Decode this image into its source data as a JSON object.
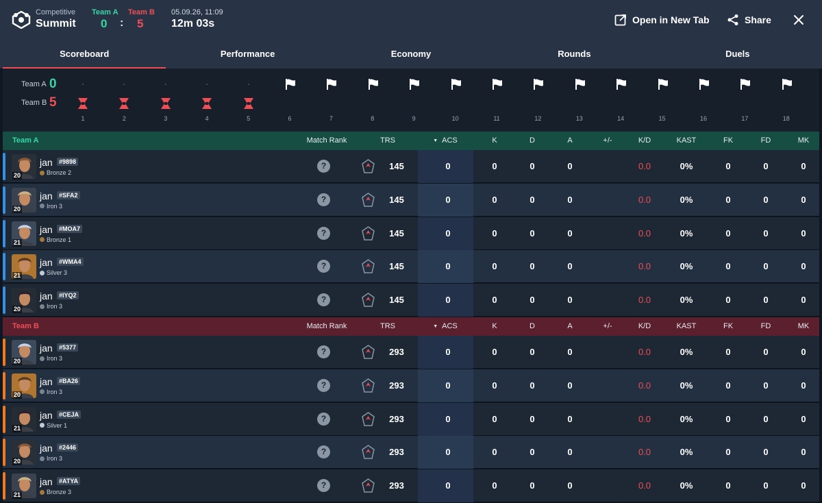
{
  "header": {
    "mode": "Competitive",
    "map": "Summit",
    "team_a_label": "Team A",
    "team_b_label": "Team B",
    "score_a": "0",
    "score_separator": ":",
    "score_b": "5",
    "date": "05.09.26, 11:09",
    "duration": "12m 03s",
    "open_new_tab": "Open in New Tab",
    "share": "Share"
  },
  "tabs": [
    "Scoreboard",
    "Performance",
    "Economy",
    "Rounds",
    "Duels"
  ],
  "active_tab": "Scoreboard",
  "timeline": {
    "team_a_label": "Team A",
    "team_a_score": "0",
    "team_b_label": "Team B",
    "team_b_score": "5",
    "rounds": [
      "1",
      "2",
      "3",
      "4",
      "5",
      "6",
      "7",
      "8",
      "9",
      "10",
      "11",
      "12",
      "13",
      "14",
      "15",
      "16",
      "17",
      "18"
    ],
    "team_b_won": [
      1,
      2,
      3,
      4,
      5
    ],
    "future_rounds": [
      6,
      7,
      8,
      9,
      10,
      11,
      12,
      13,
      14,
      15,
      16,
      17,
      18
    ]
  },
  "colors": {
    "team_a": "#38d6a4",
    "team_b": "#ef4e55",
    "team_a_header": "#174e43",
    "team_b_header": "#5b1f2d",
    "team_a_bar": "#3b8fe0",
    "team_b_bar": "#f07a24",
    "tab_underline": "#ef4e55"
  },
  "columns": {
    "match_rank": "Match Rank",
    "trs": "TRS",
    "acs": "ACS",
    "k": "K",
    "d": "D",
    "a": "A",
    "plus_minus": "+/-",
    "kd": "K/D",
    "kast": "KAST",
    "fk": "FK",
    "fd": "FD",
    "mk": "MK"
  },
  "teams": [
    {
      "name": "Team A",
      "players": [
        {
          "name": "jan",
          "tag": "#9898",
          "rank": "Bronze 2",
          "level": "20",
          "match_rank": "?",
          "trs": "145",
          "acs": "0",
          "k": "0",
          "d": "0",
          "a": "0",
          "plus_minus": "",
          "kd": "0.0",
          "kast": "0%",
          "fk": "0",
          "fd": "0",
          "mk": "0"
        },
        {
          "name": "jan",
          "tag": "#SFA2",
          "rank": "Iron 3",
          "level": "20",
          "match_rank": "?",
          "trs": "145",
          "acs": "0",
          "k": "0",
          "d": "0",
          "a": "0",
          "plus_minus": "",
          "kd": "0.0",
          "kast": "0%",
          "fk": "0",
          "fd": "0",
          "mk": "0"
        },
        {
          "name": "jan",
          "tag": "#MOA7",
          "rank": "Bronze 1",
          "level": "21",
          "match_rank": "?",
          "trs": "145",
          "acs": "0",
          "k": "0",
          "d": "0",
          "a": "0",
          "plus_minus": "",
          "kd": "0.0",
          "kast": "0%",
          "fk": "0",
          "fd": "0",
          "mk": "0"
        },
        {
          "name": "jan",
          "tag": "#WMA4",
          "rank": "Silver 3",
          "level": "21",
          "match_rank": "?",
          "trs": "145",
          "acs": "0",
          "k": "0",
          "d": "0",
          "a": "0",
          "plus_minus": "",
          "kd": "0.0",
          "kast": "0%",
          "fk": "0",
          "fd": "0",
          "mk": "0"
        },
        {
          "name": "jan",
          "tag": "#IYQ2",
          "rank": "Iron 3",
          "level": "20",
          "match_rank": "?",
          "trs": "145",
          "acs": "0",
          "k": "0",
          "d": "0",
          "a": "0",
          "plus_minus": "",
          "kd": "0.0",
          "kast": "0%",
          "fk": "0",
          "fd": "0",
          "mk": "0"
        }
      ]
    },
    {
      "name": "Team B",
      "players": [
        {
          "name": "jan",
          "tag": "#5377",
          "rank": "Iron 3",
          "level": "20",
          "match_rank": "?",
          "trs": "293",
          "acs": "0",
          "k": "0",
          "d": "0",
          "a": "0",
          "plus_minus": "",
          "kd": "0.0",
          "kast": "0%",
          "fk": "0",
          "fd": "0",
          "mk": "0"
        },
        {
          "name": "jan",
          "tag": "#BA26",
          "rank": "Iron 3",
          "level": "20",
          "match_rank": "?",
          "trs": "293",
          "acs": "0",
          "k": "0",
          "d": "0",
          "a": "0",
          "plus_minus": "",
          "kd": "0.0",
          "kast": "0%",
          "fk": "0",
          "fd": "0",
          "mk": "0"
        },
        {
          "name": "jan",
          "tag": "#CEJA",
          "rank": "Silver 1",
          "level": "21",
          "match_rank": "?",
          "trs": "293",
          "acs": "0",
          "k": "0",
          "d": "0",
          "a": "0",
          "plus_minus": "",
          "kd": "0.0",
          "kast": "0%",
          "fk": "0",
          "fd": "0",
          "mk": "0"
        },
        {
          "name": "jan",
          "tag": "#2446",
          "rank": "Iron 3",
          "level": "20",
          "match_rank": "?",
          "trs": "293",
          "acs": "0",
          "k": "0",
          "d": "0",
          "a": "0",
          "plus_minus": "",
          "kd": "0.0",
          "kast": "0%",
          "fk": "0",
          "fd": "0",
          "mk": "0"
        },
        {
          "name": "jan",
          "tag": "#ATYA",
          "rank": "Bronze 3",
          "level": "21",
          "match_rank": "?",
          "trs": "293",
          "acs": "0",
          "k": "0",
          "d": "0",
          "a": "0",
          "plus_minus": "",
          "kd": "0.0",
          "kast": "0%",
          "fk": "0",
          "fd": "0",
          "mk": "0"
        }
      ]
    }
  ]
}
